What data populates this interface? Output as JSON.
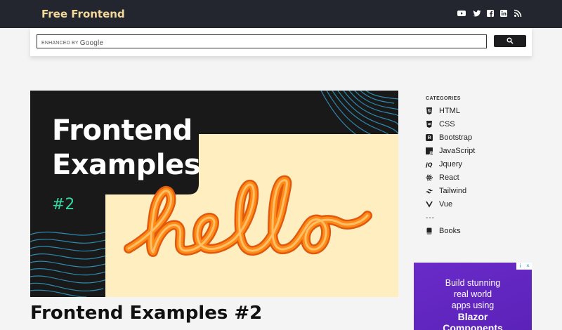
{
  "header": {
    "brand": "Free Frontend",
    "social": [
      "youtube-icon",
      "twitter-icon",
      "facebook-icon",
      "linkedin-icon",
      "rss-icon"
    ]
  },
  "search": {
    "enhanced_by": "ENHANCED BY",
    "google": "Google",
    "button_icon": "search-icon"
  },
  "hero": {
    "title_line1": "Frontend",
    "title_line2": "Examples",
    "number": "#2",
    "script_word": "hello"
  },
  "post": {
    "title": "Frontend Examples #2"
  },
  "sidebar": {
    "heading": "CATEGORIES",
    "categories": [
      {
        "label": "HTML",
        "icon": "html5-icon"
      },
      {
        "label": "CSS",
        "icon": "css3-icon"
      },
      {
        "label": "Bootstrap",
        "icon": "bootstrap-icon"
      },
      {
        "label": "JavaScript",
        "icon": "javascript-icon"
      },
      {
        "label": "Jquery",
        "icon": "jquery-icon"
      },
      {
        "label": "React",
        "icon": "react-icon"
      },
      {
        "label": "Tailwind",
        "icon": "tailwind-icon"
      },
      {
        "label": "Vue",
        "icon": "vue-icon"
      }
    ],
    "separator": "---",
    "books": {
      "label": "Books",
      "icon": "book-icon"
    }
  },
  "ad": {
    "line1": "Build stunning",
    "line2": "real world",
    "line3": "apps using",
    "line4": "Blazor",
    "line5": "Components",
    "close_info": "i",
    "close_x": "×"
  },
  "colors": {
    "header_bg": "#24262f",
    "brand": "#f2d99a",
    "hero_accent": "#37d6a0",
    "hero_panel": "#ffeec0",
    "hello_orange": "#ff8a16",
    "ad_bg": "#5b22b8"
  }
}
